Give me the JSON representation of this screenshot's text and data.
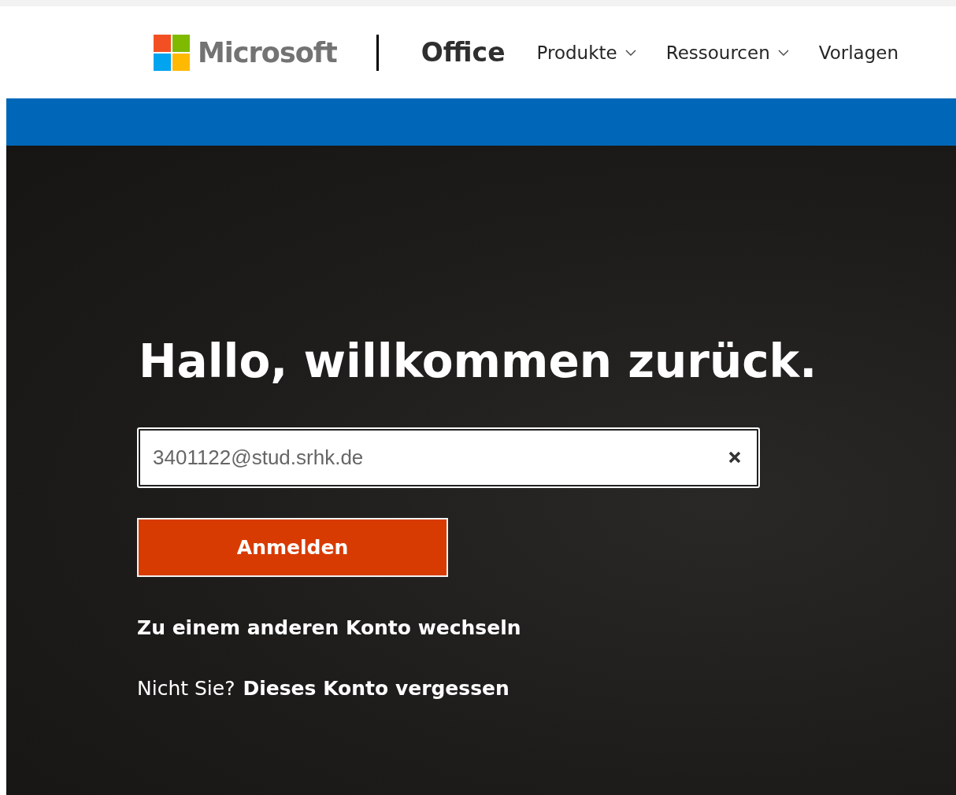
{
  "header": {
    "brand": "Microsoft",
    "product": "Office",
    "nav": [
      {
        "label": "Produkte",
        "dropdown": true
      },
      {
        "label": "Ressourcen",
        "dropdown": true
      },
      {
        "label": "Vorlagen",
        "dropdown": false
      }
    ]
  },
  "signin": {
    "heading": "Hallo, willkommen zurück.",
    "email": {
      "value": "3401122@stud.srhk.de"
    },
    "submit": "Anmelden",
    "switch_account": "Zu einem anderen Konto wechseln",
    "not_you": "Nicht Sie?",
    "forget": "Dieses Konto vergessen"
  }
}
